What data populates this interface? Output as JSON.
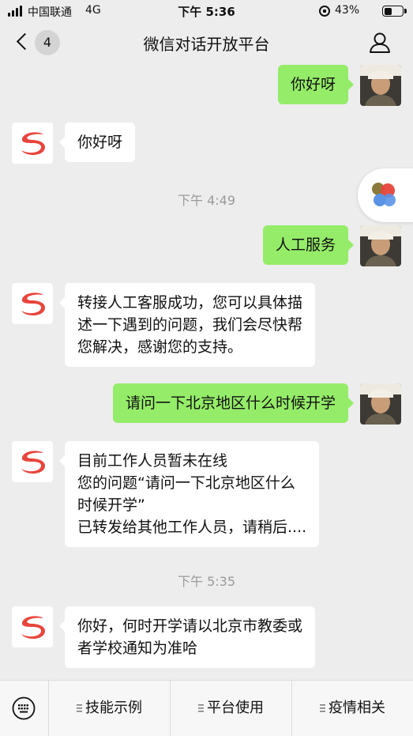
{
  "status_bar": {
    "carrier": "中国联通",
    "network": "4G",
    "time": "下午 5:36",
    "battery_percent": "43%",
    "battery_level": 0.43
  },
  "nav": {
    "unread_count": "4",
    "title": "微信对话开放平台",
    "back_icon": "chevron-left-icon",
    "profile_icon": "person-icon"
  },
  "messages": [
    {
      "side": "out",
      "text": "你好呀"
    },
    {
      "side": "in",
      "text": "你好呀"
    },
    {
      "side": "time",
      "text": "下午 4:49"
    },
    {
      "side": "out",
      "text": "人工服务"
    },
    {
      "side": "in",
      "text": "转接人工客服成功，您可以具体描\n述一下遇到的问题，我们会尽快帮\n您解决，感谢您的支持。"
    },
    {
      "side": "out",
      "text": "请问一下北京地区什么时候开学"
    },
    {
      "side": "in",
      "text": "目前工作人员暂未在线\n您的问题“请问一下北京地区什么\n时候开学”\n已转发给其他工作人员，请稍后...."
    },
    {
      "side": "time",
      "text": "下午 5:35"
    },
    {
      "side": "in",
      "text": "你好，何时开学请以北京市教委或\n者学校通知为准哈"
    }
  ],
  "bottom_menu": {
    "keyboard_icon": "keyboard-icon",
    "items": [
      "技能示例",
      "平台使用",
      "疫情相关"
    ]
  },
  "colors": {
    "background": "#ededed",
    "outgoing_bubble": "#95ec69",
    "incoming_bubble": "#ffffff",
    "bot_logo": "#e8453c"
  }
}
